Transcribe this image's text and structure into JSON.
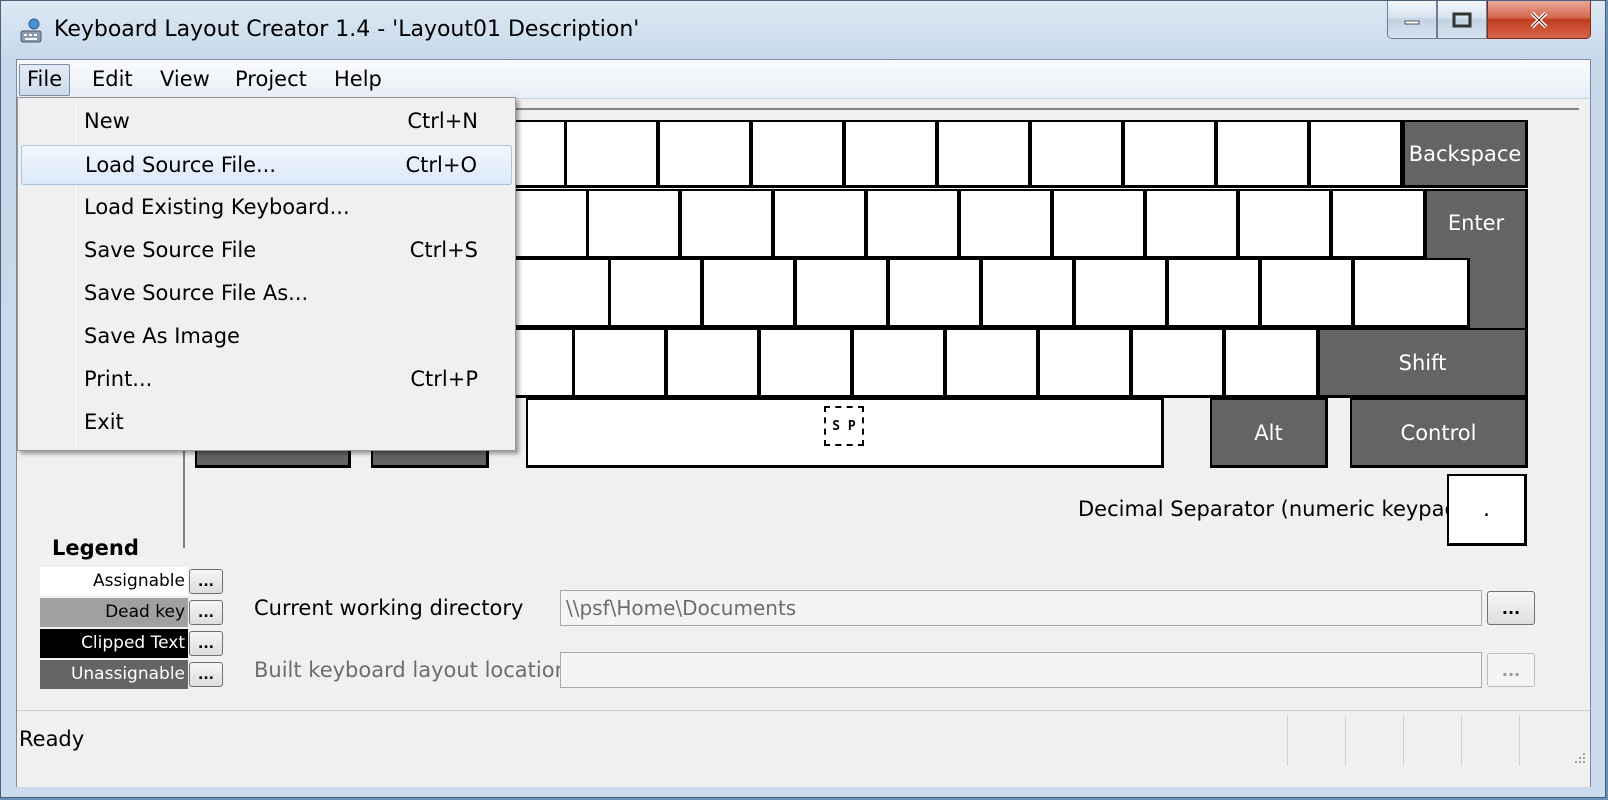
{
  "window": {
    "title": "Keyboard Layout Creator 1.4 - 'Layout01 Description'",
    "app_icon": "keyboard-app-icon",
    "caption_buttons": {
      "minimize": "minimize-icon",
      "maximize": "maximize-icon",
      "close": "close-icon"
    }
  },
  "menubar": {
    "items": [
      {
        "label": "File"
      },
      {
        "label": "Edit"
      },
      {
        "label": "View"
      },
      {
        "label": "Project"
      },
      {
        "label": "Help"
      }
    ]
  },
  "file_menu": {
    "items": [
      {
        "label": "New",
        "shortcut": "Ctrl+N"
      },
      {
        "label": "Load Source File...",
        "shortcut": "Ctrl+O"
      },
      {
        "label": "Load Existing Keyboard...",
        "shortcut": ""
      },
      {
        "label": "Save Source File",
        "shortcut": "Ctrl+S"
      },
      {
        "label": "Save Source File As...",
        "shortcut": ""
      },
      {
        "label": "Save As Image",
        "shortcut": ""
      },
      {
        "label": "Print...",
        "shortcut": "Ctrl+P"
      },
      {
        "label": "Exit",
        "shortcut": ""
      }
    ]
  },
  "keyboard": {
    "keys": {
      "backspace": "Backspace",
      "enter": "Enter",
      "shift": "Shift",
      "alt": "Alt",
      "control": "Control",
      "space": "S P"
    },
    "decimal_separator_label": "Decimal Separator (numeric keypad)",
    "decimal_separator_value": "."
  },
  "legend": {
    "title": "Legend",
    "items": [
      {
        "label": "Assignable",
        "color": "#ffffff",
        "text_color": "#000000"
      },
      {
        "label": "Dead key",
        "color": "#a0a0a0",
        "text_color": "#000000"
      },
      {
        "label": "Clipped Text",
        "color": "#000000",
        "text_color": "#ffffff"
      },
      {
        "label": "Unassignable",
        "color": "#646464",
        "text_color": "#ffffff"
      }
    ],
    "button_label": "..."
  },
  "fields": {
    "cwd_label": "Current working directory",
    "cwd_value": "\\\\psf\\Home\\Documents",
    "built_label": "Built keyboard layout location",
    "built_value": "",
    "browse_label": "..."
  },
  "status": {
    "text": "Ready"
  }
}
